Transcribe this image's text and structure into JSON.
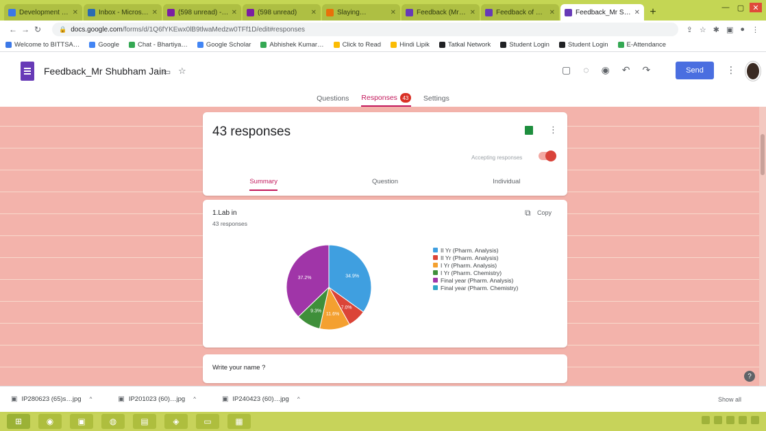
{
  "browser": {
    "tabs": [
      {
        "label": "Development ri…",
        "color": "#3b78e7"
      },
      {
        "label": "Inbox - Microsoft…",
        "color": "#2b6cb0"
      },
      {
        "label": "(598 unread) - S…",
        "color": "#7b1fa2"
      },
      {
        "label": "(598 unread)",
        "color": "#7b1fa2"
      },
      {
        "label": "Slaying…",
        "color": "#e8710a"
      },
      {
        "label": "Feedback (Mr Shu…",
        "color": "#673ab7"
      },
      {
        "label": "Feedback of Gru…",
        "color": "#673ab7"
      },
      {
        "label": "Feedback_Mr Shu…",
        "color": "#673ab7"
      }
    ],
    "address": {
      "domain": "docs.google.com",
      "path": "/forms/d/1Q6fYKEwx0lB9tlwaMedzw0TFf1D/edit#responses"
    },
    "bookmarks": [
      {
        "label": "Welcome to BITTSA…",
        "color": "#3b78e7"
      },
      {
        "label": "Google",
        "color": "#4285f4"
      },
      {
        "label": "Chat - Bhartiya…",
        "color": "#34a853"
      },
      {
        "label": "Google Scholar",
        "color": "#4285f4"
      },
      {
        "label": "Abhishek Kumar…",
        "color": "#34a853"
      },
      {
        "label": "Click to Read",
        "color": "#fbbc04"
      },
      {
        "label": "Hindi Lipik",
        "color": "#fbbc04"
      },
      {
        "label": "Tatkal Network",
        "color": "#202124"
      },
      {
        "label": "Student Login",
        "color": "#202124"
      },
      {
        "label": "Student Login",
        "color": "#202124"
      },
      {
        "label": "E-Attendance",
        "color": "#34a853"
      }
    ]
  },
  "form": {
    "title": "Feedback_Mr Shubham Jain",
    "send_label": "Send",
    "subtabs": [
      {
        "label": "Questions",
        "active": false
      },
      {
        "label": "Responses",
        "active": true,
        "badge": "43"
      },
      {
        "label": "Settings",
        "active": false
      }
    ]
  },
  "summary_card": {
    "responses_label": "43 responses",
    "accepting_label": "Accepting responses",
    "tabs": [
      "Summary",
      "Question",
      "Individual"
    ],
    "active_tab": "Summary"
  },
  "question_card": {
    "title": "1.Lab in",
    "subtitle": "43 responses",
    "copy_label": "Copy"
  },
  "next_card": {
    "title": "Write your name ?"
  },
  "chart_data": {
    "type": "pie",
    "values": [
      {
        "label": "II Yr (Pharm. Analysis)",
        "value": 34.9,
        "color": "#3f9fe0"
      },
      {
        "label": "II Yr (Pharm. Analysis)",
        "value": 7.0,
        "color": "#db4437"
      },
      {
        "label": "I Yr (Pharm. Analysis)",
        "value": 11.6,
        "color": "#f4a030"
      },
      {
        "label": "I Yr (Pharm. Chemistry)",
        "value": 9.3,
        "color": "#3f8f3a"
      },
      {
        "label": "Final year (Pharm. Analysis)",
        "value": 37.2,
        "color": "#a035a8"
      },
      {
        "label": "Final year (Pharm. Chemistry)",
        "value": 0.0,
        "color": "#30a6c8"
      }
    ]
  },
  "downloads": [
    {
      "label": "IP280623 (65)s…jpg"
    },
    {
      "label": "IP201023 (60)…jpg"
    },
    {
      "label": "IP240423 (60)…jpg"
    }
  ],
  "downloads_showall": "Show all",
  "taskbar": {
    "buttons": [
      "⊞",
      "◉",
      "▣",
      "◍",
      "▤",
      "◈",
      "▭",
      "▦"
    ]
  }
}
